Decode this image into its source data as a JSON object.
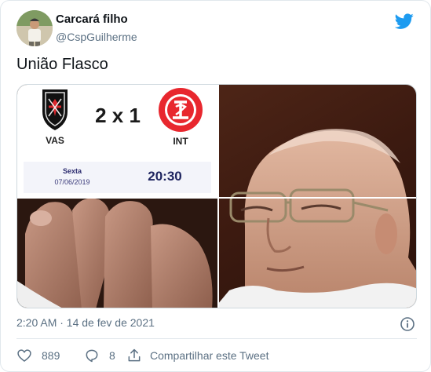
{
  "author": {
    "name": "Carcará filho",
    "handle": "@CspGuilherme",
    "avatar_icon": "user-avatar",
    "platform_icon": "twitter-bird-icon",
    "brand_color": "#1d9bf0"
  },
  "tweet": {
    "text": "União Flasco"
  },
  "media": {
    "scoreboard": {
      "home_team": "VAS",
      "away_team": "INT",
      "score": "2 x 1",
      "day": "Sexta",
      "date": "07/06/2019",
      "time": "20:30",
      "home_crest_icon": "vasco-crest-icon",
      "away_crest_icon": "internacional-crest-icon"
    },
    "photo_description_icon": "photo-grid"
  },
  "meta": {
    "timestamp": "2:20 AM · 14 de fev de 2021",
    "info_icon": "info-icon"
  },
  "actions": {
    "like_count": "889",
    "reply_count": "8",
    "share_label": "Compartilhar este Tweet"
  }
}
